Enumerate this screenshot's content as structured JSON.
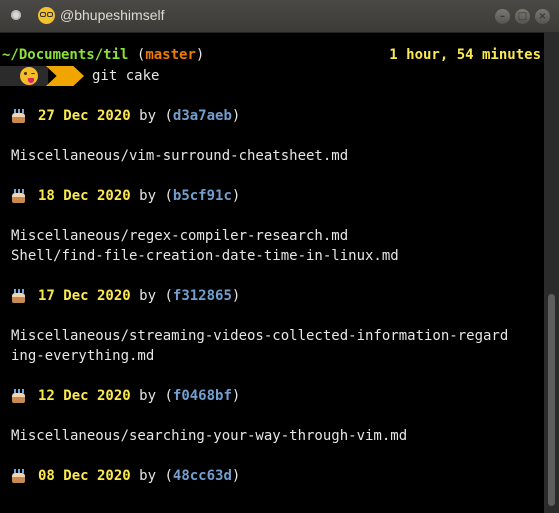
{
  "window": {
    "title": "@bhupeshimself",
    "buttons": [
      "minimize",
      "maximize",
      "close"
    ]
  },
  "prompt": {
    "path": "~/Documents/til",
    "branch": "master",
    "elapsed": "1 hour, 54 minutes",
    "command": "git cake"
  },
  "commits": [
    {
      "date": "27 Dec 2020",
      "by": "by",
      "hash": "d3a7aeb",
      "files": [
        "Miscellaneous/vim-surround-cheatsheet.md"
      ]
    },
    {
      "date": "18 Dec 2020",
      "by": "by",
      "hash": "b5cf91c",
      "files": [
        "Miscellaneous/regex-compiler-research.md",
        "Shell/find-file-creation-date-time-in-linux.md"
      ]
    },
    {
      "date": "17 Dec 2020",
      "by": "by",
      "hash": "f312865",
      "files": [
        "Miscellaneous/streaming-videos-collected-information-regard",
        "ing-everything.md"
      ]
    },
    {
      "date": "12 Dec 2020",
      "by": "by",
      "hash": "f0468bf",
      "files": [
        "Miscellaneous/searching-your-way-through-vim.md"
      ]
    },
    {
      "date": "08 Dec 2020",
      "by": "by",
      "hash": "48cc63d",
      "files": []
    }
  ],
  "icons": {
    "terminal": "terminal-icon",
    "title_emoji": "nerd-face-emoji-icon",
    "prompt_emoji": "winking-tongue-face-emoji-icon",
    "commit": "birthday-cake-icon"
  },
  "colors": {
    "path": "#8ae234",
    "branch": "#ef7a00",
    "date": "#fce94f",
    "hash": "#729fcf",
    "background": "#000000"
  }
}
